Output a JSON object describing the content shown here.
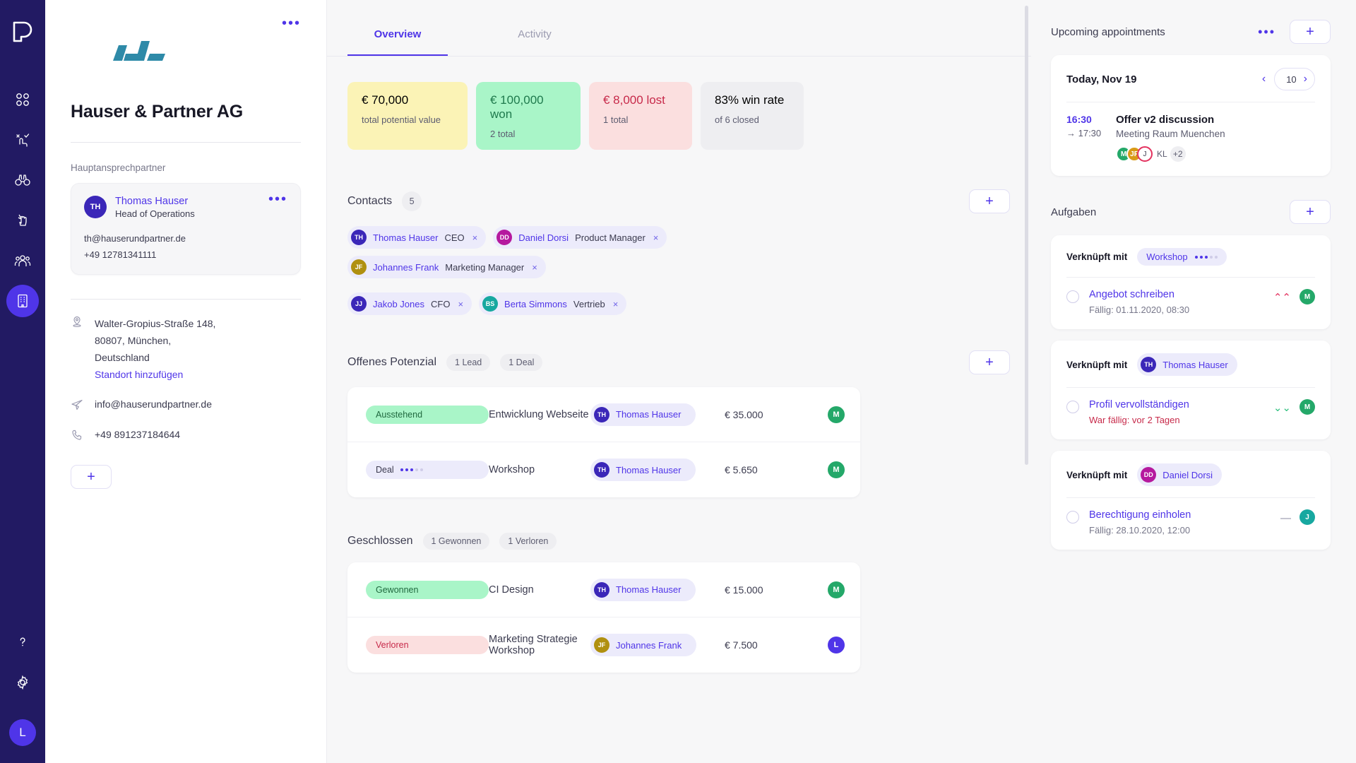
{
  "rail": {
    "logo_icon": "app-logo-icon",
    "items": [
      {
        "icon": "dashboard-grid-icon",
        "active": false
      },
      {
        "icon": "tasks-check-icon",
        "active": false
      },
      {
        "icon": "binoculars-icon",
        "active": false
      },
      {
        "icon": "hand-pointer-icon",
        "active": false
      },
      {
        "icon": "people-group-icon",
        "active": false
      },
      {
        "icon": "building-company-icon",
        "active": true
      }
    ],
    "help_icon": "help-question-icon",
    "settings_icon": "gear-icon",
    "user_avatar": "L"
  },
  "company": {
    "menu_dots": "•••",
    "name": "Hauser & Partner AG",
    "contact_label": "Hauptansprechpartner",
    "primary_contact": {
      "initials": "TH",
      "avatar_color": "#3b27b8",
      "name": "Thomas Hauser",
      "role": "Head of Operations",
      "email": "th@hauserundpartner.de",
      "phone": "+49 12781341111",
      "menu_dots": "•••"
    },
    "address_lines": [
      "Walter-Gropius-Straße 148,",
      "80807, München,",
      "Deutschland"
    ],
    "address_link": "Standort hinzufügen",
    "email": "info@hauserundpartner.de",
    "phone": "+49 891237184644",
    "add_label": "+"
  },
  "main": {
    "tabs": [
      {
        "label": "Overview",
        "active": true
      },
      {
        "label": "Activity",
        "active": false
      }
    ],
    "stats": [
      {
        "value": "€ 70,000",
        "caption": "total potential value",
        "tone": "yellow"
      },
      {
        "value": "€ 100,000 won",
        "caption": "2 total",
        "tone": "green"
      },
      {
        "value": "€ 8,000 lost",
        "caption": "1 total",
        "tone": "red"
      },
      {
        "value": "83% win rate",
        "caption": "of 6 closed",
        "tone": "grey"
      }
    ],
    "contacts": {
      "title": "Contacts",
      "count": "5",
      "add_label": "+",
      "items": [
        {
          "initials": "TH",
          "color": "#3b27b8",
          "name": "Thomas Hauser",
          "role": "CEO",
          "close": "×"
        },
        {
          "initials": "DD",
          "color": "#b5199e",
          "name": "Daniel Dorsi",
          "role": "Product Manager",
          "close": "×"
        },
        {
          "initials": "JF",
          "color": "#b09010",
          "name": "Johannes Frank",
          "role": "Marketing Manager",
          "close": "×"
        },
        {
          "initials": "JJ",
          "color": "#3b27b8",
          "name": "Jakob Jones",
          "role": "CFO",
          "close": "×"
        },
        {
          "initials": "BS",
          "color": "#17a8a0",
          "name": "Berta Simmons",
          "role": "Vertrieb",
          "close": "×"
        }
      ]
    },
    "open_potential": {
      "title": "Offenes Potenzial",
      "pills": [
        "1 Lead",
        "1 Deal"
      ],
      "add_label": "+",
      "rows": [
        {
          "badge": "Ausstehend",
          "badge_tone": "ausstehend",
          "dots": 0,
          "title": "Entwicklung Webseite",
          "owner": {
            "initials": "TH",
            "color": "#3b27b8",
            "name": "Thomas Hauser"
          },
          "amount": "€ 35.000",
          "assignee": {
            "initials": "M",
            "color": "#24a869"
          }
        },
        {
          "badge": "Deal",
          "badge_tone": "deal",
          "dots": 3,
          "title": "Workshop",
          "owner": {
            "initials": "TH",
            "color": "#3b27b8",
            "name": "Thomas Hauser"
          },
          "amount": "€ 5.650",
          "assignee": {
            "initials": "M",
            "color": "#24a869"
          }
        }
      ]
    },
    "closed": {
      "title": "Geschlossen",
      "pills": [
        "1 Gewonnen",
        "1 Verloren"
      ],
      "rows": [
        {
          "badge": "Gewonnen",
          "badge_tone": "gewonnen",
          "dots": 0,
          "title": "CI Design",
          "owner": {
            "initials": "TH",
            "color": "#3b27b8",
            "name": "Thomas Hauser"
          },
          "amount": "€ 15.000",
          "assignee": {
            "initials": "M",
            "color": "#24a869"
          }
        },
        {
          "badge": "Verloren",
          "badge_tone": "verloren",
          "dots": 0,
          "title": "Marketing Strategie Workshop",
          "owner": {
            "initials": "JF",
            "color": "#b09010",
            "name": "Johannes Frank"
          },
          "amount": "€ 7.500",
          "assignee": {
            "initials": "L",
            "color": "#4f35e8"
          }
        }
      ]
    }
  },
  "right": {
    "appointments": {
      "title": "Upcoming appointments",
      "menu_dots": "•••",
      "add_label": "+",
      "date_label": "Today, Nov 19",
      "prev_icon": "chevron-left-icon",
      "next_icon": "chevron-right-icon",
      "count": "10",
      "event": {
        "start": "16:30",
        "end": "→ 17:30",
        "name": "Offer v2 discussion",
        "location": "Meeting Raum Muenchen",
        "attendees": [
          {
            "initials": "M",
            "color": "#24a869",
            "ring": false
          },
          {
            "initials": "JF",
            "color": "#d99a16",
            "ring": false
          },
          {
            "initials": "J",
            "color": "#ffffff",
            "ring": true
          }
        ],
        "more_label": "KL",
        "overflow": "+2"
      }
    },
    "tasks": {
      "title": "Aufgaben",
      "add_label": "+",
      "linked_label": "Verknüpft mit",
      "items": [
        {
          "link_type": "deal",
          "link_name": "Workshop",
          "link_dots": 3,
          "name": "Angebot schreiben",
          "due": "Fällig: 01.11.2020, 08:30",
          "overdue": false,
          "priority_icon": "priority-high-icon",
          "priority": "high",
          "priority_glyph": "⌃⌃",
          "assignee": {
            "initials": "M",
            "color": "#24a869"
          }
        },
        {
          "link_type": "person",
          "link_initials": "TH",
          "link_color": "#3b27b8",
          "link_name": "Thomas Hauser",
          "name": "Profil vervollständigen",
          "due": "War fällig: vor 2 Tagen",
          "overdue": true,
          "priority_icon": "priority-low-icon",
          "priority": "low",
          "priority_glyph": "⌄⌄",
          "assignee": {
            "initials": "M",
            "color": "#24a869"
          }
        },
        {
          "link_type": "person",
          "link_initials": "DD",
          "link_color": "#b5199e",
          "link_name": "Daniel Dorsi",
          "name": "Berechtigung einholen",
          "due": "Fällig: 28.10.2020, 12:00",
          "overdue": false,
          "priority_icon": "priority-medium-icon",
          "priority": "mid",
          "priority_glyph": "—",
          "assignee": {
            "initials": "J",
            "color": "#17a8a0"
          }
        }
      ]
    }
  },
  "colors": {
    "accent": "#4f35e8",
    "rail_bg": "#221a63",
    "green": "#a9f5c8",
    "red": "#fbdfdf",
    "yellow": "#fbf3b6",
    "brand_logo": "#2e8aa8"
  }
}
